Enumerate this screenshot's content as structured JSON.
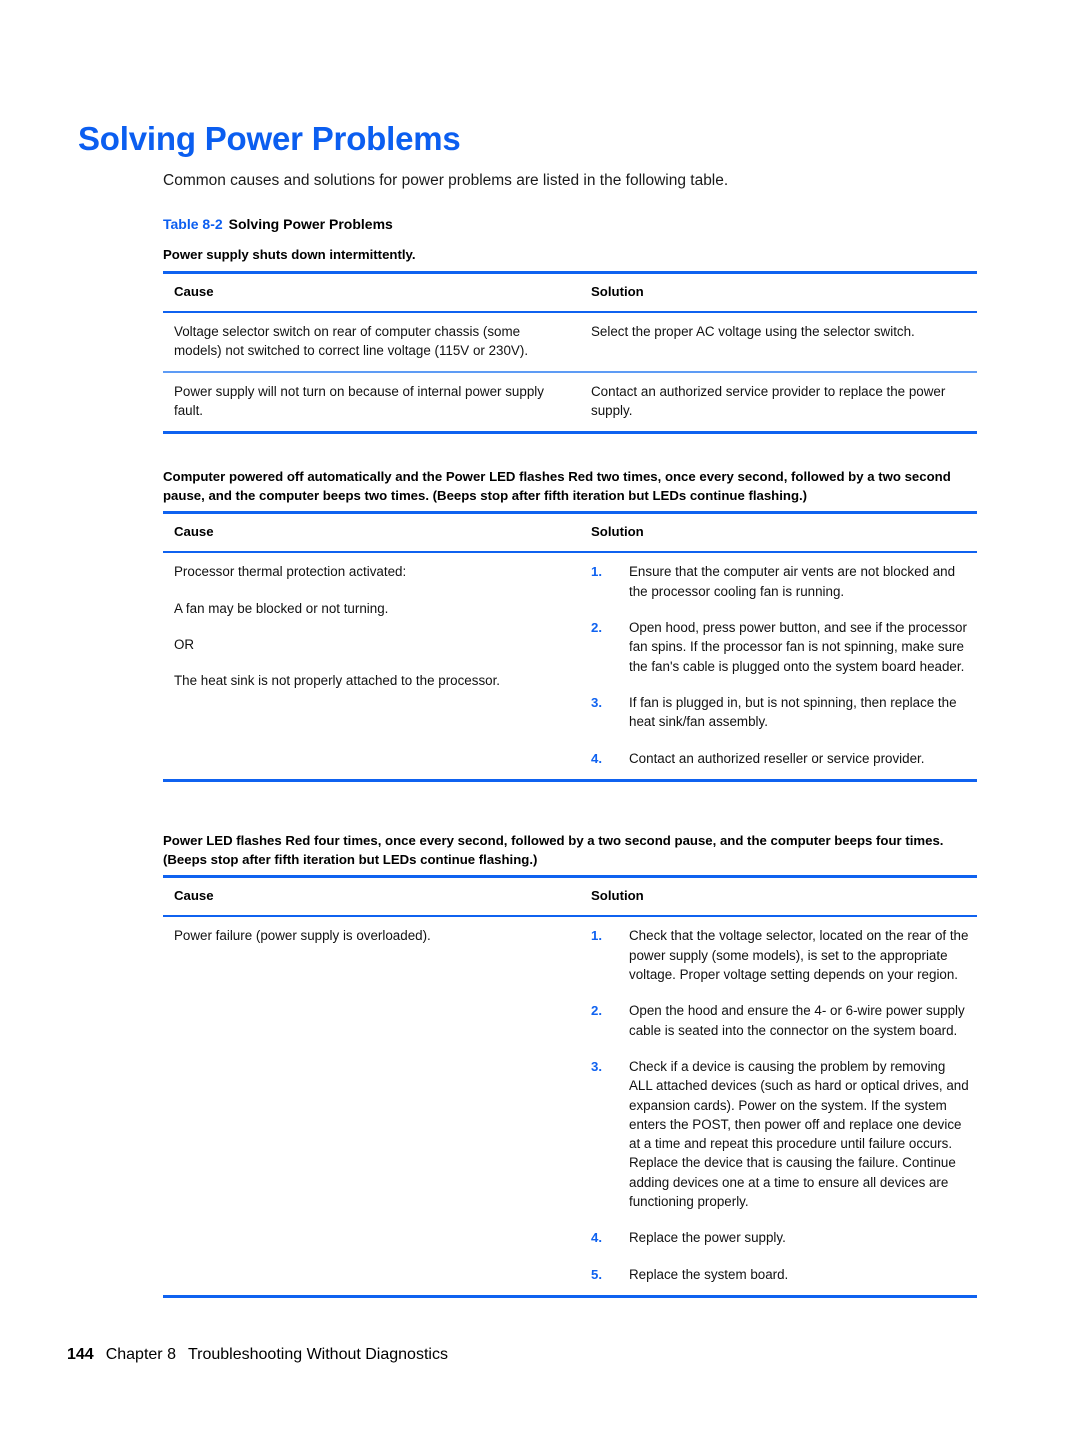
{
  "document": {
    "title": "Solving Power Problems",
    "intro": "Common causes and solutions for power problems are listed in the following table.",
    "table_caption_label": "Table 8-2",
    "table_caption_title": "Solving Power Problems",
    "accent_color": "#0b5ef0",
    "rule_color": "#0f62f0"
  },
  "column_headers": {
    "cause": "Cause",
    "solution": "Solution"
  },
  "sections": [
    {
      "condition": "Power supply shuts down intermittently.",
      "rows": [
        {
          "cause_paragraphs": [
            "Voltage selector switch on rear of computer chassis (some models) not switched to correct line voltage (115V or 230V)."
          ],
          "solution_paragraphs": [
            "Select the proper AC voltage using the selector switch."
          ],
          "solution_steps": []
        },
        {
          "cause_paragraphs": [
            "Power supply will not turn on because of internal power supply fault."
          ],
          "solution_paragraphs": [
            "Contact an authorized service provider to replace the power supply."
          ],
          "solution_steps": []
        }
      ]
    },
    {
      "condition": "Computer powered off automatically and the Power LED flashes Red two times, once every second, followed by a two second pause, and the computer beeps two times. (Beeps stop after fifth iteration but LEDs continue flashing.)",
      "rows": [
        {
          "cause_paragraphs": [
            "Processor thermal protection activated:",
            "A fan may be blocked or not turning.",
            "OR",
            "The heat sink is not properly attached to the processor."
          ],
          "solution_paragraphs": [],
          "solution_steps": [
            {
              "num": "1.",
              "text": "Ensure that the computer air vents are not blocked and the processor cooling fan is running."
            },
            {
              "num": "2.",
              "text": "Open hood, press power button, and see if the processor fan spins. If the processor fan is not spinning, make sure the fan's cable is plugged onto the system board header."
            },
            {
              "num": "3.",
              "text": "If fan is plugged in, but is not spinning, then replace the heat sink/fan assembly."
            },
            {
              "num": "4.",
              "text": "Contact an authorized reseller or service provider."
            }
          ]
        }
      ]
    },
    {
      "condition": "Power LED flashes Red four times, once every second, followed by a two second pause, and the computer beeps four times. (Beeps stop after fifth iteration but LEDs continue flashing.)",
      "rows": [
        {
          "cause_paragraphs": [
            "Power failure (power supply is overloaded)."
          ],
          "solution_paragraphs": [],
          "solution_steps": [
            {
              "num": "1.",
              "text": "Check that the voltage selector, located on the rear of the power supply (some models), is set to the appropriate voltage. Proper voltage setting depends on your region."
            },
            {
              "num": "2.",
              "text": "Open the hood and ensure the 4- or 6-wire power supply cable is seated into the connector on the system board."
            },
            {
              "num": "3.",
              "text": "Check if a device is causing the problem by removing ALL attached devices (such as hard or optical drives, and expansion cards). Power on the system. If the system enters the POST, then power off and replace one device at a time and repeat this procedure until failure occurs. Replace the device that is causing the failure. Continue adding devices one at a time to ensure all devices are functioning properly."
            },
            {
              "num": "4.",
              "text": "Replace the power supply."
            },
            {
              "num": "5.",
              "text": "Replace the system board."
            }
          ]
        }
      ]
    }
  ],
  "footer": {
    "page_number": "144",
    "chapter": "Chapter 8",
    "chapter_title": "Troubleshooting Without Diagnostics"
  }
}
